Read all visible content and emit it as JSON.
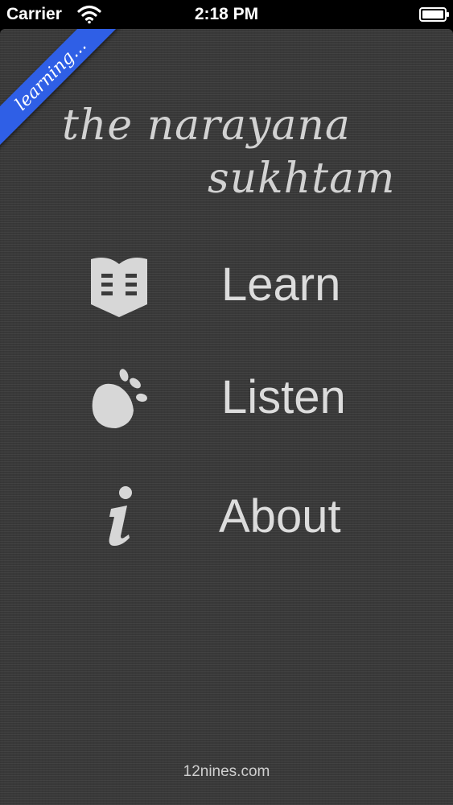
{
  "status_bar": {
    "carrier": "Carrier",
    "time": "2:18 PM",
    "wifi_icon": "wifi-icon",
    "battery_icon": "battery-icon"
  },
  "ribbon": {
    "label": "learning..."
  },
  "title": {
    "line1": "the narayana",
    "line2": "sukhtam"
  },
  "menu": {
    "items": [
      {
        "label": "Learn",
        "icon": "book-icon"
      },
      {
        "label": "Listen",
        "icon": "footprint-icon"
      },
      {
        "label": "About",
        "icon": "info-icon"
      }
    ]
  },
  "footer": {
    "text": "12nines.com"
  },
  "colors": {
    "background": "#3b3b3b",
    "ribbon": "#2f5fe6",
    "text": "#dcdcdc"
  }
}
